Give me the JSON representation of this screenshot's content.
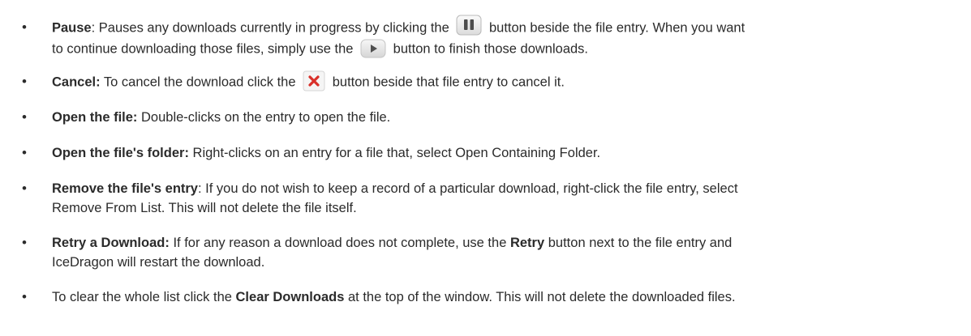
{
  "items": [
    {
      "title": "Pause",
      "sep": ": ",
      "text_a": "Pauses any downloads currently in progress by clicking the",
      "text_b": "button beside the file entry. When you want",
      "text_c": "to continue downloading those files, simply use the",
      "text_d": "button to finish those downloads."
    },
    {
      "title": "Cancel:",
      "text_a": " To cancel the download click the",
      "text_b": "button beside that file entry to cancel it."
    },
    {
      "title": "Open the file:",
      "text": " Double-clicks on the entry to open the file."
    },
    {
      "title": "Open the file's folder:",
      "text": " Right-clicks on an entry for a file that, select Open Containing Folder."
    },
    {
      "title": "Remove the file's entry",
      "text_a": ": If you do not wish to keep a record of a particular download, right-click the file entry, select",
      "text_b": "Remove From List. This will not delete the file itself."
    },
    {
      "title": "Retry a Download:",
      "text_a": " If for any reason a download does not complete, use the ",
      "bold_a": "Retry",
      "text_b": " button next to the file entry and",
      "text_c": "IceDragon will restart the download."
    },
    {
      "text_a": "To clear the whole list click the ",
      "bold_a": "Clear Downloads",
      "text_b": " at the top of the window. This will not delete the downloaded files."
    }
  ],
  "bullet": "•",
  "icons": {
    "pause": "pause-button-icon",
    "play": "play-button-icon",
    "cancel": "cancel-x-icon"
  },
  "colors": {
    "text": "#2b2b2b",
    "cancel_red": "#d9302a",
    "icon_gray": "#5a5a5a"
  }
}
